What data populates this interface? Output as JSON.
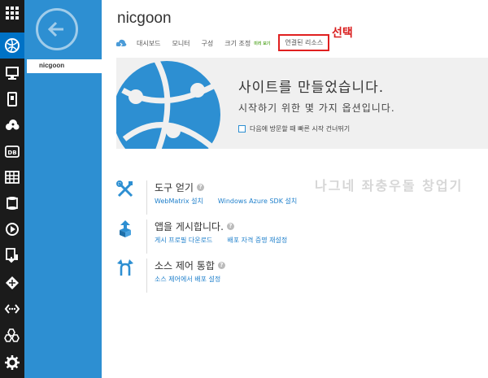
{
  "sidebar": {
    "rail_icons": [
      "grid-icon",
      "web-sites-icon",
      "virtual-machines-icon",
      "mobile-services-icon",
      "cloud-services-icon",
      "sql-databases-icon",
      "storage-icon",
      "hdinsight-icon",
      "media-services-icon",
      "service-bus-icon",
      "visual-studio-online-icon",
      "networks-icon",
      "traffic-manager-icon",
      "settings-icon"
    ],
    "selected_site": "nicgoon"
  },
  "header": {
    "title": "nicgoon",
    "tabs": [
      {
        "label": "대시보드"
      },
      {
        "label": "모니터"
      },
      {
        "label": "구성"
      },
      {
        "label": "크기 조정",
        "badge": "미리 보기"
      },
      {
        "label": "연결된 리소스"
      }
    ],
    "annotation": "선택"
  },
  "hero": {
    "title": "사이트를 만들었습니다.",
    "subtitle": "시작하기 위한 몇 가지 옵션입니다.",
    "checkbox_label": "다음에 방문할 때 빠른 시작 건너뛰기"
  },
  "tasks": [
    {
      "title": "도구 얻기",
      "icon": "tools-icon",
      "links": [
        "WebMatrix 설치",
        "Windows Azure SDK 설치"
      ]
    },
    {
      "title": "앱을 게시합니다.",
      "icon": "publish-icon",
      "links": [
        "게시 프로필 다운로드",
        "배포 자격 증명 재설정"
      ]
    },
    {
      "title": "소스 제어 통합",
      "icon": "source-control-icon",
      "links": [
        "소스 제어에서 배포 설정"
      ]
    }
  ],
  "watermark": "나그네 좌충우돌 창업기",
  "colors": {
    "rail_bg": "#1b1b1b",
    "rail_active": "#0072c6",
    "panel_bg": "#2d8fd2",
    "link": "#1e7fcb",
    "annotation": "#d91d1d",
    "hero_bg": "#f0f0f0"
  }
}
